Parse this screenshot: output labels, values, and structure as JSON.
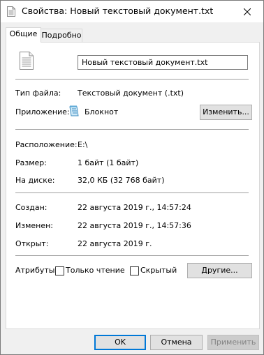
{
  "window": {
    "title": "Свойства: Новый текстовый документ.txt"
  },
  "tabs": [
    {
      "label": "Общие",
      "active": true
    },
    {
      "label": "Подробно",
      "active": false
    }
  ],
  "general": {
    "file_name": "Новый текстовый документ.txt",
    "file_type_label": "Тип файла:",
    "file_type_value": "Текстовый документ (.txt)",
    "app_label": "Приложение:",
    "app_value": "Блокнот",
    "change_button": "Изменить...",
    "location_label": "Расположение:",
    "location_value": "E:\\",
    "size_label": "Размер:",
    "size_value": "1 байт (1 байт)",
    "disk_label": "На диске:",
    "disk_value": "32,0 КБ (32 768 байт)",
    "created_label": "Создан:",
    "created_value": "22 августа 2019 г., 14:57:24",
    "modified_label": "Изменен:",
    "modified_value": "22 августа 2019 г., 14:57:36",
    "opened_label": "Открыт:",
    "opened_value": "22 августа 2019 г.",
    "attributes_label": "Атрибуты:",
    "readonly_label": "Только чтение",
    "readonly_checked": false,
    "hidden_label": "Скрытый",
    "hidden_checked": false,
    "other_button": "Другие..."
  },
  "footer": {
    "ok": "OK",
    "cancel": "Отмена",
    "apply": "Применить"
  },
  "icons": {
    "title": "text-file-icon",
    "file": "text-file-icon",
    "app": "notepad-icon",
    "close": "close-icon"
  },
  "colors": {
    "accent": "#0078d7",
    "titlebar": "#ffffff",
    "window_bg": "#f0f0f0"
  }
}
